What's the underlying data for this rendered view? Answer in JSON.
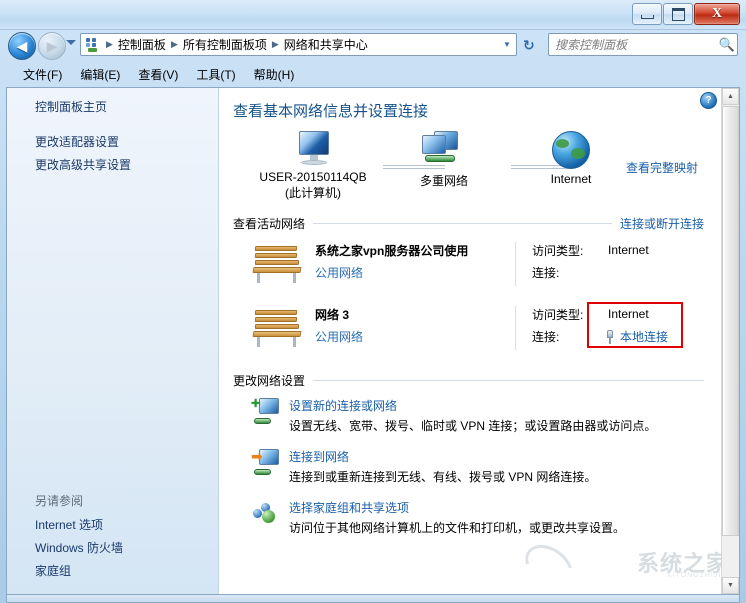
{
  "window": {
    "minimize_label": "最小化",
    "restore_label": "还原",
    "close_label": "X"
  },
  "nav": {
    "back_label": "◄",
    "forward_label": "►",
    "recent_pages_label": "▼",
    "refresh_label": "↻",
    "breadcrumb": [
      "控制面板",
      "所有控制面板项",
      "网络和共享中心"
    ],
    "breadcrumb_separator": "►",
    "breadcrumb_dropdown": "▼"
  },
  "search": {
    "placeholder": "搜索控制面板",
    "value": "",
    "icon": "search-icon"
  },
  "menubar": {
    "items": [
      "文件(F)",
      "编辑(E)",
      "查看(V)",
      "工具(T)",
      "帮助(H)"
    ]
  },
  "sidebar": {
    "home_label": "控制面板主页",
    "items": [
      "更改适配器设置",
      "更改高级共享设置"
    ],
    "see_also_title": "另请参阅",
    "see_also_items": [
      "Internet 选项",
      "Windows 防火墙",
      "家庭组"
    ]
  },
  "main": {
    "help_label": "?",
    "page_title": "查看基本网络信息并设置连接",
    "network_map": {
      "view_full_map": "查看完整映射",
      "nodes": [
        {
          "label": "USER-20150114QB",
          "sublabel": "(此计算机)",
          "icon": "computer-monitor-icon"
        },
        {
          "label": "多重网络",
          "sublabel": "",
          "icon": "multiple-networks-icon"
        },
        {
          "label": "Internet",
          "sublabel": "",
          "icon": "globe-icon"
        }
      ]
    },
    "active_networks": {
      "heading": "查看活动网络",
      "action_link": "连接或断开连接",
      "rows": [
        {
          "name": "系统之家vpn服务器公司使用",
          "type": "公用网络",
          "access_key": "访问类型:",
          "access_value": "Internet",
          "connection_key": "连接:",
          "connection_value": "",
          "highlighted": false
        },
        {
          "name": "网络 3",
          "type": "公用网络",
          "access_key": "访问类型:",
          "access_value": "Internet",
          "connection_key": "连接:",
          "connection_value": "本地连接",
          "highlighted": true
        }
      ]
    },
    "change_settings": {
      "heading": "更改网络设置",
      "items": [
        {
          "link": "设置新的连接或网络",
          "desc": "设置无线、宽带、拨号、临时或 VPN 连接；或设置路由器或访问点。",
          "icon": "new-connection-icon"
        },
        {
          "link": "连接到网络",
          "desc": "连接到或重新连接到无线、有线、拨号或 VPN 网络连接。",
          "icon": "connect-to-network-icon"
        },
        {
          "link": "选择家庭组和共享选项",
          "desc": "访问位于其他网络计算机上的文件和打印机，或更改共享设置。",
          "icon": "homegroup-icon"
        }
      ]
    }
  },
  "watermark": {
    "text": "系统之家",
    "subtext": "XITONGZHIJIA"
  },
  "colors": {
    "link": "#1a5fa8",
    "title": "#16538c",
    "highlight_box": "#e00000",
    "titlebar": "#cbe2f6"
  }
}
